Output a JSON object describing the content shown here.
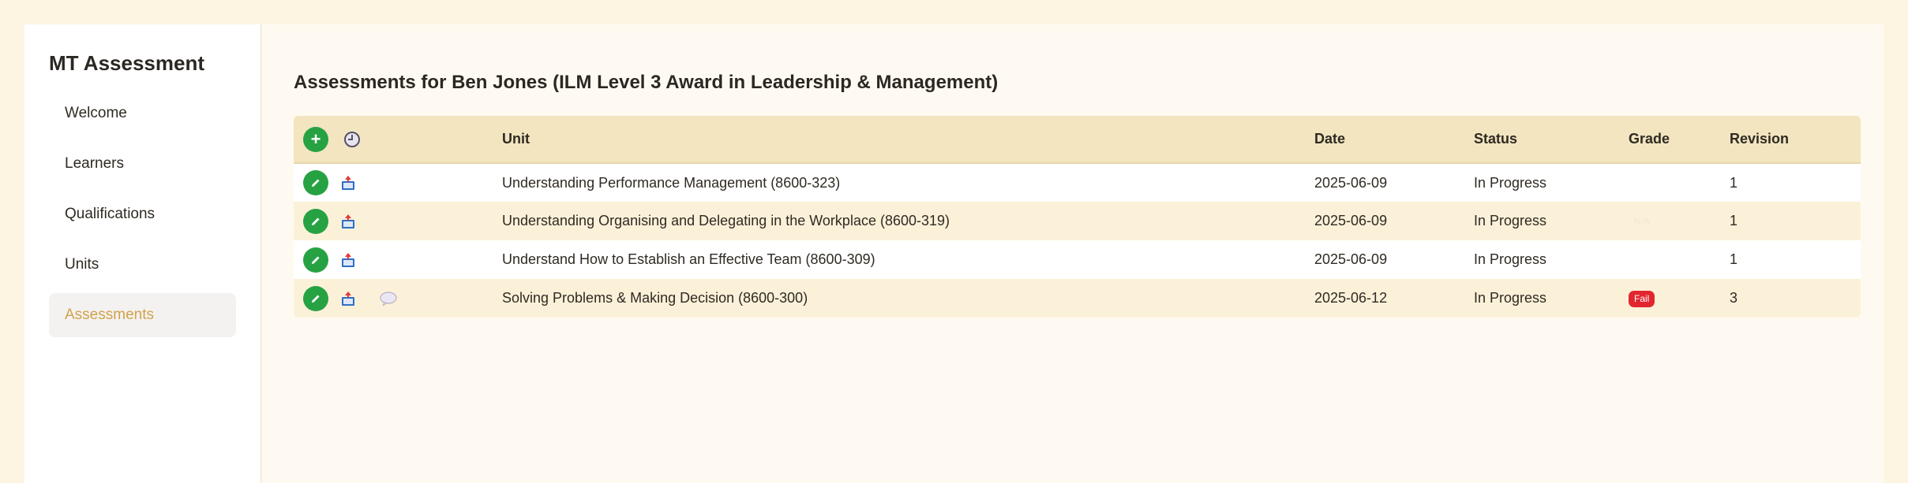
{
  "app": {
    "title": "MT Assessment"
  },
  "sidebar": {
    "items": [
      {
        "label": "Welcome",
        "active": false
      },
      {
        "label": "Learners",
        "active": false
      },
      {
        "label": "Qualifications",
        "active": false
      },
      {
        "label": "Units",
        "active": false
      },
      {
        "label": "Assessments",
        "active": true
      }
    ]
  },
  "main": {
    "title": "Assessments for Ben Jones (ILM Level 3 Award in Leadership & Management)"
  },
  "table": {
    "header": {
      "unit": "Unit",
      "date": "Date",
      "status": "Status",
      "grade": "Grade",
      "revision": "Revision"
    },
    "add_label": "+",
    "rows": [
      {
        "unit": "Understanding Performance Management (8600-323)",
        "date": "2025-06-09",
        "status": "In Progress",
        "grade": "",
        "revision": "1"
      },
      {
        "unit": "Understanding Organising and Delegating in the Workplace (8600-319)",
        "date": "2025-06-09",
        "status": "In Progress",
        "grade": "N/A",
        "revision": "1"
      },
      {
        "unit": "Understand How to Establish an Effective Team (8600-309)",
        "date": "2025-06-09",
        "status": "In Progress",
        "grade": "",
        "revision": "1"
      },
      {
        "unit": "Solving Problems & Making Decision (8600-300)",
        "date": "2025-06-12",
        "status": "In Progress",
        "grade": "Fail",
        "revision": "3"
      }
    ]
  },
  "icons": {
    "add": "plus-icon",
    "history": "clock-icon",
    "edit": "pencil-icon",
    "view": "book-icon",
    "comments": "speech-bubble-icon"
  },
  "colors": {
    "accent_green": "#27a243",
    "fail_red": "#e2262f",
    "active_nav_text": "#d2a24c",
    "header_bg": "#f2e5c0"
  }
}
